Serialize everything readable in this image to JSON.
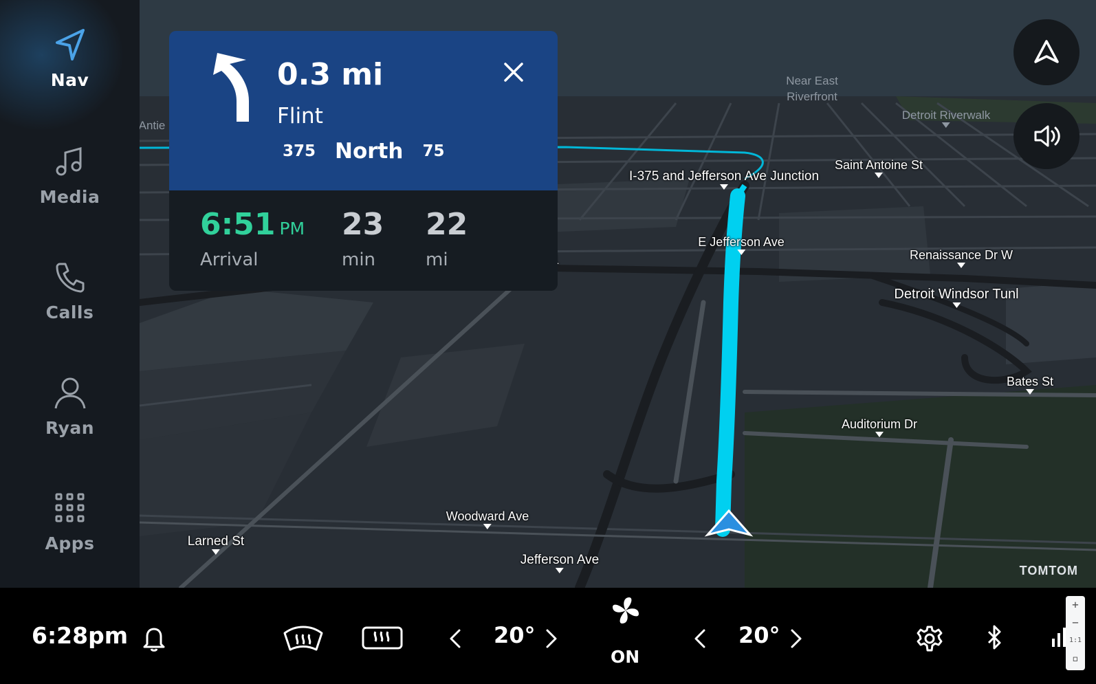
{
  "sidebar": {
    "items": [
      {
        "label": "Nav",
        "icon": "navigation-arrow-icon",
        "active": true
      },
      {
        "label": "Media",
        "icon": "music-note-icon",
        "active": false
      },
      {
        "label": "Calls",
        "icon": "phone-icon",
        "active": false
      },
      {
        "label": "Ryan",
        "icon": "user-profile-icon",
        "active": false
      },
      {
        "label": "Apps",
        "icon": "apps-grid-icon",
        "active": false
      }
    ]
  },
  "direction": {
    "distance": "0.3 mi",
    "street": "Flint",
    "route_shield_1": "375",
    "route_direction": "North",
    "route_shield_2": "75",
    "maneuver_icon": "turn-left-arrow-icon"
  },
  "eta": {
    "time": "6:51",
    "ampm": "PM",
    "arrival_label": "Arrival",
    "minutes": "23",
    "minutes_label": "min",
    "distance": "22",
    "distance_label": "mi"
  },
  "map": {
    "labels": {
      "antie": "Antie",
      "near_east": "Near East",
      "riverfront": "Riverfront",
      "detroit_riverwalk": "Detroit Riverwalk",
      "saint_antoine": "Saint Antoine St",
      "i375_junction": "I-375 and Jefferson Ave Junction",
      "e_jefferson": "E Jefferson Ave",
      "renaissance": "Renaissance Dr W",
      "detroit_windsor": "Detroit Windsor Tunl",
      "bates": "Bates St",
      "auditorium": "Auditorium Dr",
      "woodward": "Woodward Ave",
      "larned": "Larned St",
      "jefferson": "Jefferson Ave",
      "partial_m1": "1"
    },
    "brand": "TOMTOM"
  },
  "colors": {
    "route": "#00d0f0",
    "accent_green": "#31d19b",
    "card_blue": "#1a4484"
  },
  "bottom_bar": {
    "clock": "6:28pm",
    "temp_left": "20°",
    "temp_right": "20°",
    "fan_label": "ON",
    "icons": [
      "bell-icon",
      "front-defrost-icon",
      "rear-defrost-icon",
      "chevron-left-icon",
      "chevron-right-icon",
      "fan-icon",
      "settings-gear-icon",
      "bluetooth-icon",
      "signal-icon"
    ]
  },
  "zoom_controls": {
    "zoom_in": "+",
    "zoom_out": "−",
    "reset": "1:1"
  }
}
